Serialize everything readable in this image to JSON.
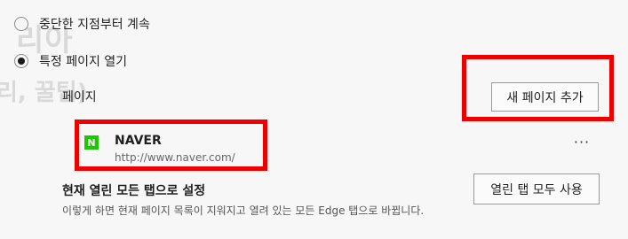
{
  "watermark": {
    "line1": "리아",
    "line2": "리, 꿀팁)"
  },
  "startup": {
    "option_continue_label": "중단한 지점부터 계속",
    "option_specific_label": "특정 페이지 열기",
    "selected": "specific"
  },
  "pages": {
    "section_label": "페이지",
    "add_button_label": "새 페이지 추가",
    "items": [
      {
        "favicon_letter": "N",
        "name": "NAVER",
        "url": "http://www.naver.com/",
        "favicon_color": "#1ec800"
      }
    ],
    "more_label": "···"
  },
  "set_current": {
    "title": "현재 열린 모든 탭으로 설정",
    "description": "이렇게 하면 현재 페이지 목록이 지워지고 열려 있는 모든 Edge 탭으로 바뀝니다.",
    "button_label": "열린 탭 모두 사용"
  },
  "colors": {
    "highlight": "#ee0000",
    "naver_green": "#1ec800",
    "background": "#f7f7f7"
  }
}
